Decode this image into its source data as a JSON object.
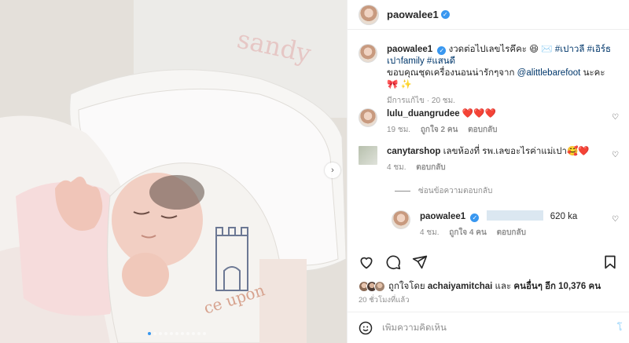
{
  "post": {
    "username": "paowalee1",
    "carousel_dots": 11,
    "carousel_active": 0
  },
  "caption": {
    "username": "paowalee1",
    "line1": "งวดต่อไปเลขไรคึคะ 😆 ✉️",
    "tags": [
      "#เปาวลี",
      "#เอิร์ธเปาfamily",
      "#แสนดี"
    ],
    "line2_prefix": "ขอบคุณชุดเครื่องนอนน่ารักๆจาก",
    "mention": "@alittlebarefoot",
    "line2_suffix": "นะคะ 🎀 ✨",
    "meta": "มีการแก้ไข · 20 ชม."
  },
  "comments": [
    {
      "username": "lulu_duangrudee",
      "text": "❤️❤️❤️",
      "time": "19 ชม.",
      "likes": "ถูกใจ 2 คน",
      "reply": "ตอบกลับ"
    },
    {
      "username": "canytarshop",
      "text": "เลขห้องที่ รพ.เลขอะไรค่าแม่เปา🥰❤️",
      "time": "4 ชม.",
      "reply": "ตอบกลับ"
    }
  ],
  "hidden_replies_label": "ซ่อนข้อความตอบกลับ",
  "reply": {
    "username": "paowalee1",
    "text": "620 ka",
    "time": "4 ชม.",
    "likes": "ถูกใจ 4 คน",
    "reply": "ตอบกลับ"
  },
  "likes": {
    "prefix": "ถูกใจโดย",
    "user": "achaiyamitchai",
    "middle": "และ",
    "others": "คนอื่นๆ อีก 10,376 คน"
  },
  "posted_time": "20 ชั่วโมงที่แล้ว",
  "add_comment": {
    "placeholder": "เพิ่มความคิดเห็น",
    "post_label": "โ"
  },
  "colors": {
    "link": "#00376b",
    "verified": "#3897f0",
    "carousel_active": "#3797ef"
  },
  "photo_text": {
    "pillow_name": "sandy",
    "blanket_text": "ce upon"
  }
}
